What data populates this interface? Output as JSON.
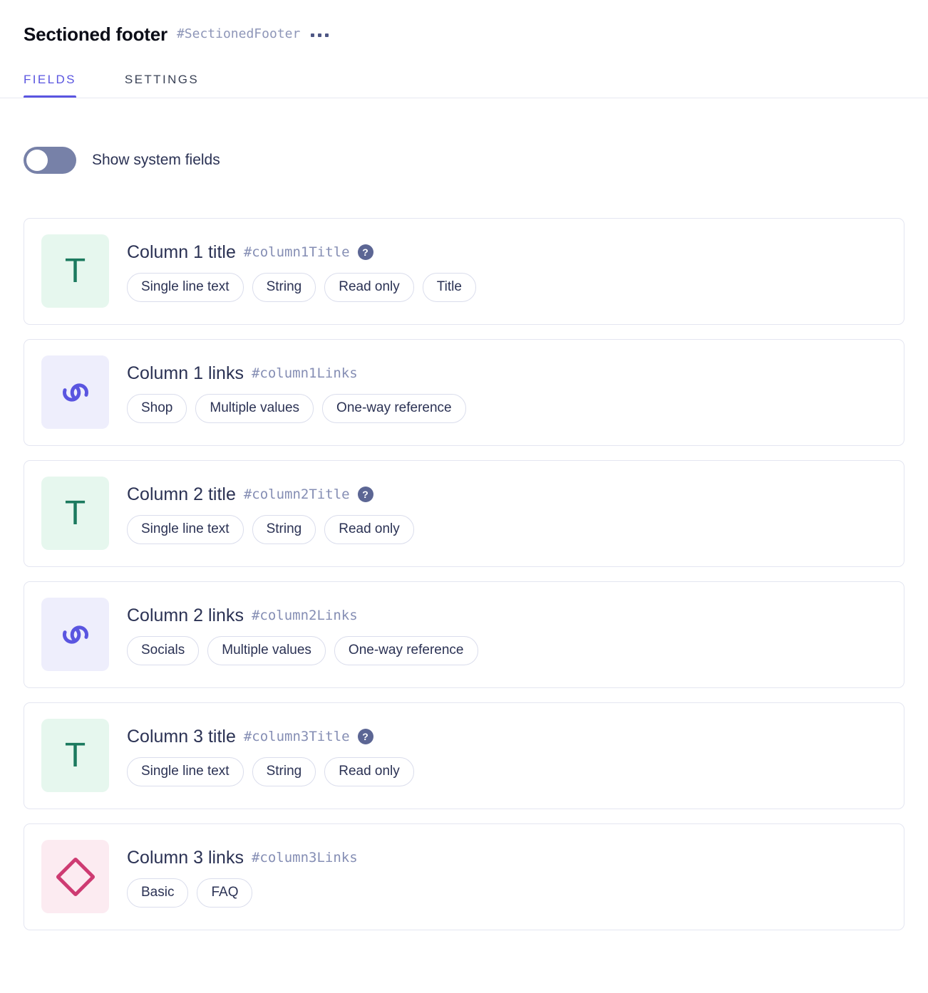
{
  "header": {
    "title": "Sectioned footer",
    "api_id": "#SectionedFooter",
    "menu_icon": "kebab-menu-icon"
  },
  "tabs": [
    {
      "label": "FIELDS",
      "active": true
    },
    {
      "label": "SETTINGS",
      "active": false
    }
  ],
  "system_fields_toggle": {
    "label": "Show system fields",
    "checked": false,
    "track_color": "#7781A8",
    "knob_color": "#FFFFFF"
  },
  "colors": {
    "accent": "#5A55E0",
    "text_primary": "#2B3254",
    "text_muted": "#858EB4",
    "card_border": "#E4E6F1",
    "tag_border": "#DADDEC",
    "icon_text_bg": "#E6F7EE",
    "icon_text_fg": "#1B7A5E",
    "icon_link_bg": "#EEEEFC",
    "icon_link_fg": "#5A55E0",
    "icon_basic_bg": "#FCEBF1",
    "icon_basic_fg": "#CE3B72"
  },
  "fields": [
    {
      "name": "Column 1 title",
      "api_id": "#column1Title",
      "icon": "text-field-icon",
      "icon_kind": "text",
      "glyph": "T",
      "has_help": true,
      "tags": [
        "Single line text",
        "String",
        "Read only",
        "Title"
      ]
    },
    {
      "name": "Column 1 links",
      "api_id": "#column1Links",
      "icon": "link-field-icon",
      "icon_kind": "link",
      "glyph": "link",
      "has_help": false,
      "tags": [
        "Shop",
        "Multiple values",
        "One-way reference"
      ]
    },
    {
      "name": "Column 2 title",
      "api_id": "#column2Title",
      "icon": "text-field-icon",
      "icon_kind": "text",
      "glyph": "T",
      "has_help": true,
      "tags": [
        "Single line text",
        "String",
        "Read only"
      ]
    },
    {
      "name": "Column 2 links",
      "api_id": "#column2Links",
      "icon": "link-field-icon",
      "icon_kind": "link",
      "glyph": "link",
      "has_help": false,
      "tags": [
        "Socials",
        "Multiple values",
        "One-way reference"
      ]
    },
    {
      "name": "Column 3 title",
      "api_id": "#column3Title",
      "icon": "text-field-icon",
      "icon_kind": "text",
      "glyph": "T",
      "has_help": true,
      "tags": [
        "Single line text",
        "String",
        "Read only"
      ]
    },
    {
      "name": "Column 3 links",
      "api_id": "#column3Links",
      "icon": "basic-field-icon",
      "icon_kind": "basic",
      "glyph": "diamond",
      "has_help": false,
      "tags": [
        "Basic",
        "FAQ"
      ]
    }
  ],
  "help_icon_char": "?"
}
